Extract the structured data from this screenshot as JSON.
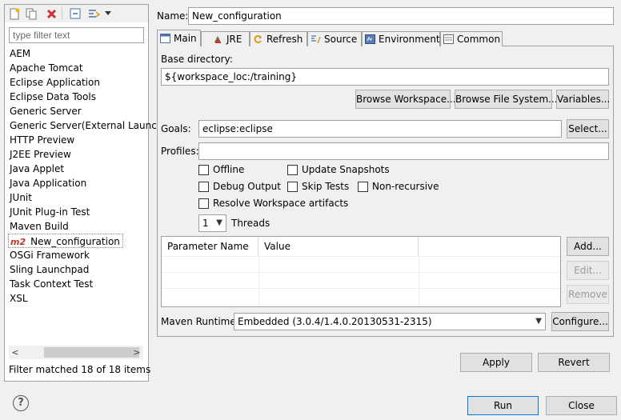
{
  "toolbar": {
    "new_icon": "new-configuration-icon",
    "duplicate_icon": "duplicate-icon",
    "delete_icon": "delete-icon",
    "collapse_icon": "collapse-all-icon",
    "filter_icon": "filter-icon",
    "menu_icon": "dropdown-menu-icon"
  },
  "filter": {
    "placeholder": "type filter text"
  },
  "tree": {
    "items": [
      "AEM",
      "Apache Tomcat",
      "Eclipse Application",
      "Eclipse Data Tools",
      "Generic Server",
      "Generic Server(External Launch)",
      "HTTP Preview",
      "J2EE Preview",
      "Java Applet",
      "Java Application",
      "JUnit",
      "JUnit Plug-in Test",
      "Maven Build",
      "New_configuration",
      "OSGi Framework",
      "Sling Launchpad",
      "Task Context Test",
      "XSL"
    ],
    "selected_prefix": "m2",
    "scroll_left": "<",
    "scroll_right": ">"
  },
  "status": "Filter matched 18 of 18 items",
  "name": {
    "label": "Name:",
    "value": "New_configuration"
  },
  "tabs": [
    "Main",
    "JRE",
    "Refresh",
    "Source",
    "Environment",
    "Common"
  ],
  "main": {
    "base_dir_label": "Base directory:",
    "base_dir_value": "${workspace_loc:/training}",
    "browse_workspace": "Browse Workspace...",
    "browse_fs": "Browse File System...",
    "variables": "Variables...",
    "goals_label": "Goals:",
    "goals_value": "eclipse:eclipse",
    "select": "Select...",
    "profiles_label": "Profiles:",
    "profiles_value": "",
    "checkboxes": {
      "offline": "Offline",
      "update_snapshots": "Update Snapshots",
      "debug_output": "Debug Output",
      "skip_tests": "Skip Tests",
      "non_recursive": "Non-recursive",
      "resolve_workspace": "Resolve Workspace artifacts"
    },
    "threads_value": "1",
    "threads_label": "Threads",
    "table": {
      "col1": "Parameter Name",
      "col2": "Value"
    },
    "add": "Add...",
    "edit": "Edit...",
    "remove": "Remove",
    "runtime_label": "Maven Runtime:",
    "runtime_value": "Embedded (3.0.4/1.4.0.20130531-2315)",
    "configure": "Configure..."
  },
  "apply": "Apply",
  "revert": "Revert",
  "run": "Run",
  "close": "Close",
  "help_icon": "help-icon"
}
